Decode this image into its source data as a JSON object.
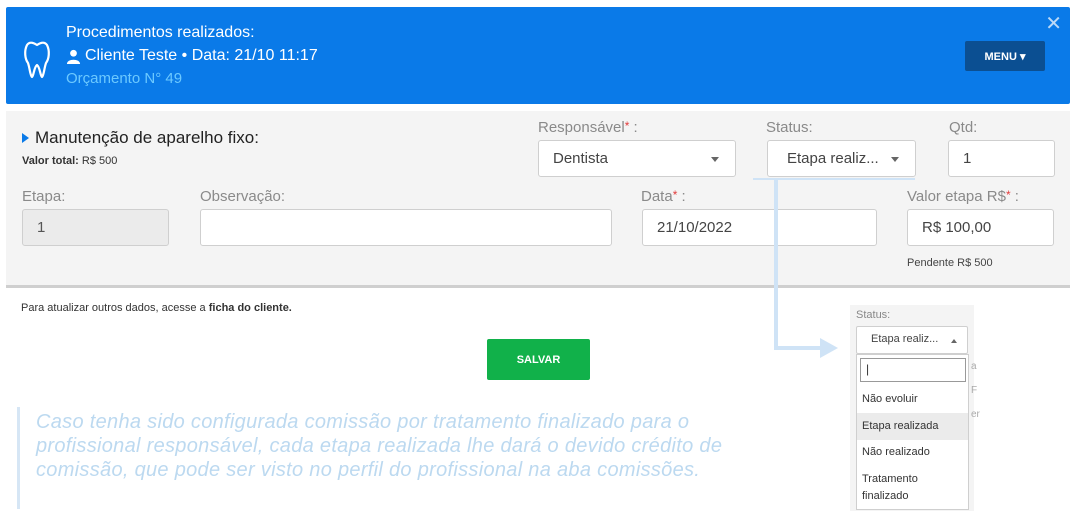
{
  "header": {
    "title": "Procedimentos realizados:",
    "client_line": "Cliente Teste • Data: 21/10 11:17",
    "quote_line": "Orçamento N° 49",
    "menu_label": "MENU ▾",
    "close_label": "✕"
  },
  "procedure": {
    "title": "Manutenção de aparelho fixo:",
    "total_label": "Valor total:",
    "total_value": "R$ 500",
    "responsavel_label": "Responsável",
    "responsavel_value": "Dentista",
    "status_label": "Status:",
    "status_value": "Etapa realiz...",
    "qtd_label": "Qtd:",
    "qtd_value": "1",
    "etapa_label": "Etapa:",
    "etapa_value": "1",
    "obs_label": "Observação:",
    "obs_value": "",
    "data_label": "Data",
    "data_value": "21/10/2022",
    "valor_etapa_label": "Valor etapa R$",
    "valor_etapa_value": "R$ 100,00",
    "pending": "Pendente R$ 500"
  },
  "footer": {
    "note_prefix": "Para atualizar outros dados, acesse a",
    "note_link": "ficha do cliente.",
    "save_label": "SALVAR"
  },
  "callout": {
    "text": "Caso tenha sido configurada comissão por tratamento finalizado para o profissional responsável, cada etapa realizada lhe dará o devido crédito de comissão, que pode ser visto no perfil do profissional na aba comissões."
  },
  "zoom": {
    "status_label": "Status:",
    "status_value": "Etapa realiz...",
    "options": [
      "Não evoluir",
      "Etapa realizada",
      "Não realizado",
      "Tratamento finalizado"
    ],
    "selected": "Etapa realizada"
  },
  "colors": {
    "header_bg": "#0a7ae8",
    "menu_bg": "#0b4f92",
    "save_bg": "#11b14a",
    "required": "#e23b3b"
  }
}
